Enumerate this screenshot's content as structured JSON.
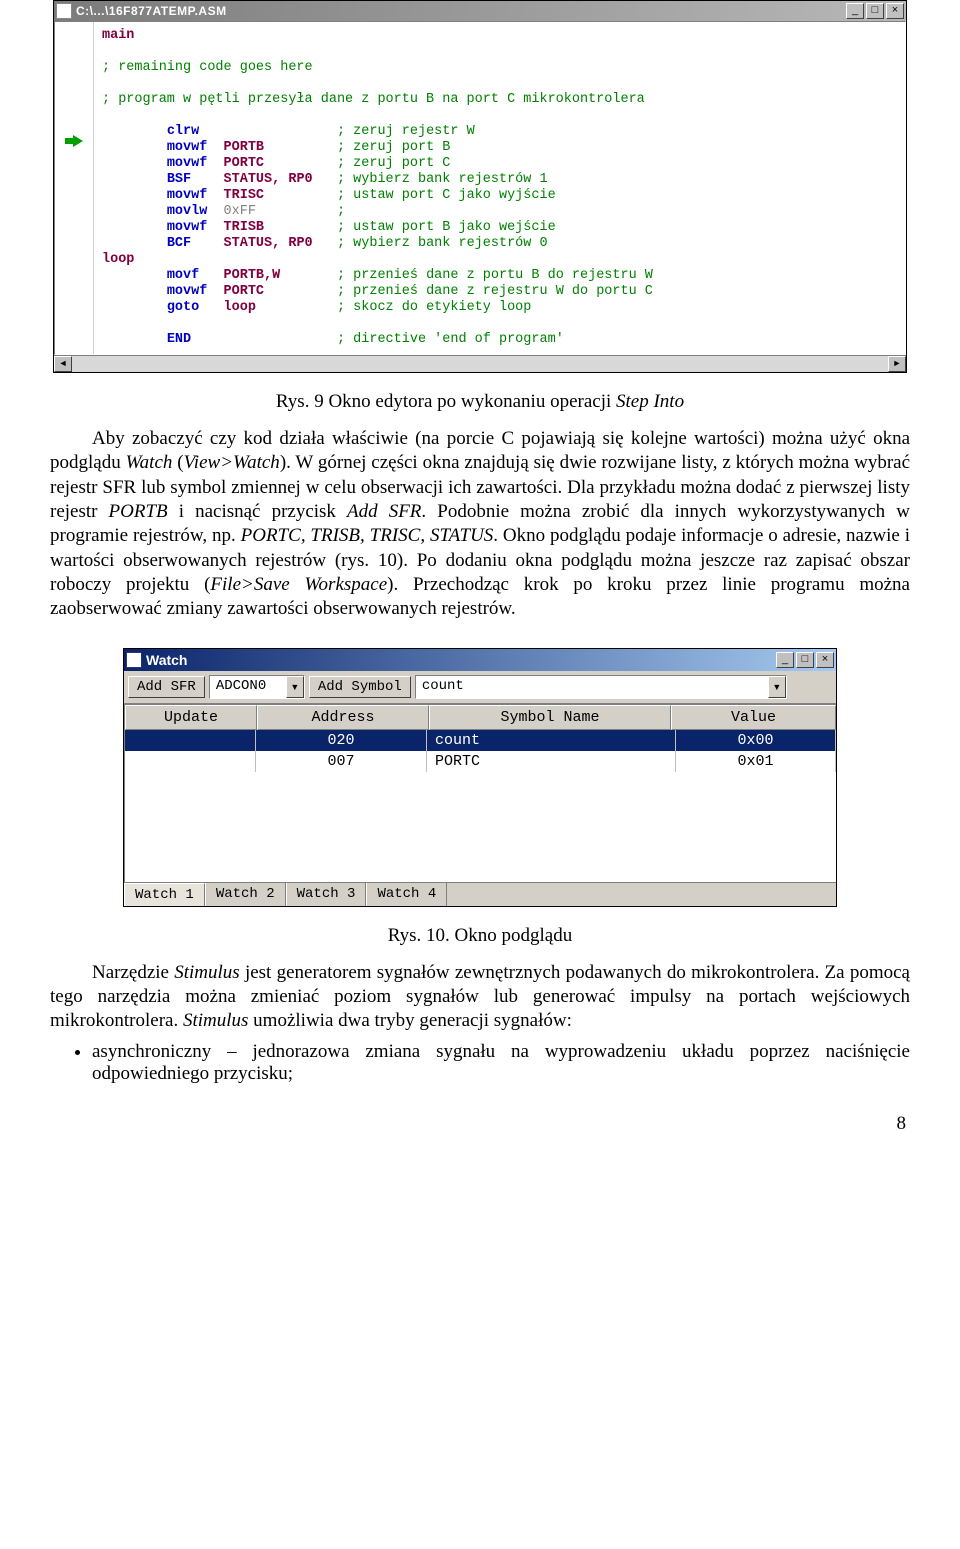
{
  "editor": {
    "title": "C:\\...\\16F877ATEMP.ASM",
    "btn_min": "_",
    "btn_max": "□",
    "btn_close": "×",
    "scroll_left": "◄",
    "scroll_right": "►",
    "code_lines": [
      {
        "lbl": "main",
        "op": "",
        "arg": "",
        "cmt": ""
      },
      {
        "lbl": "",
        "op": "",
        "arg": "",
        "cmt": ""
      },
      {
        "lbl": "",
        "op": "",
        "arg": "",
        "cmt": "; remaining code goes here"
      },
      {
        "lbl": "",
        "op": "",
        "arg": "",
        "cmt": ""
      },
      {
        "lbl": "",
        "op": "",
        "arg": "",
        "cmt": "; program w pętli przesyła dane z portu B na port C mikrokontrolera"
      },
      {
        "lbl": "",
        "op": "",
        "arg": "",
        "cmt": ""
      },
      {
        "lbl": "",
        "op": "clrw",
        "arg": "",
        "cmt": "; zeruj rejestr W"
      },
      {
        "lbl": "",
        "op": "movwf",
        "arg": "PORTB",
        "cmt": "; zeruj port B"
      },
      {
        "lbl": "",
        "op": "movwf",
        "arg": "PORTC",
        "cmt": "; zeruj port C"
      },
      {
        "lbl": "",
        "op": "BSF",
        "arg": "STATUS, RP0",
        "cmt": "; wybierz bank rejestrów 1"
      },
      {
        "lbl": "",
        "op": "movwf",
        "arg": "TRISC",
        "cmt": "; ustaw port C jako wyjście"
      },
      {
        "lbl": "",
        "op": "movlw",
        "arg": "0xFF",
        "cmt": ";"
      },
      {
        "lbl": "",
        "op": "movwf",
        "arg": "TRISB",
        "cmt": "; ustaw port B jako wejście"
      },
      {
        "lbl": "",
        "op": "BCF",
        "arg": "STATUS, RP0",
        "cmt": "; wybierz bank rejestrów 0"
      },
      {
        "lbl": "loop",
        "op": "",
        "arg": "",
        "cmt": ""
      },
      {
        "lbl": "",
        "op": "movf",
        "arg": "PORTB,W",
        "cmt": "; przenieś dane z portu B do rejestru W"
      },
      {
        "lbl": "",
        "op": "movwf",
        "arg": "PORTC",
        "cmt": "; przenieś dane z rejestru W do portu C"
      },
      {
        "lbl": "",
        "op": "goto",
        "arg": "loop",
        "cmt": "; skocz do etykiety loop"
      },
      {
        "lbl": "",
        "op": "",
        "arg": "",
        "cmt": ""
      },
      {
        "lbl": "",
        "op": "END",
        "arg": "",
        "cmt": "; directive 'end of program'"
      }
    ]
  },
  "text": {
    "cap1": "Rys. 9 Okno edytora po wykonaniu operacji ",
    "cap1_it": "Step Into",
    "p1a": "Aby zobaczyć czy kod działa właściwie (na porcie C pojawiają się kolejne wartości) można użyć okna podglądu ",
    "p1b": "Watch",
    "p1c": " (",
    "p1d": "View>Watch",
    "p1e": "). W górnej części okna znajdują się dwie rozwijane listy, z których można wybrać rejestr SFR lub symbol zmiennej w celu obserwacji ich zawartości. Dla przykładu można dodać z pierwszej listy rejestr ",
    "p1f": "PORTB",
    "p1g": " i nacisnąć przycisk ",
    "p1h": "Add SFR",
    "p1i": ". Podobnie można zrobić dla innych wykorzystywanych w programie rejestrów, np. ",
    "p1j": "PORTC, TRISB, TRISC, STATUS",
    "p1k": ". Okno podglądu podaje informacje o adresie, nazwie i wartości obserwowanych rejestrów (rys. 10). Po dodaniu okna podglądu można jeszcze raz zapisać obszar roboczy projektu (",
    "p1l": "File>Save Workspace",
    "p1m": "). Przechodząc krok po kroku przez linie programu można zaobserwować zmiany zawartości obserwowanych rejestrów.",
    "cap2": "Rys. 10. Okno podglądu",
    "p2a": "Narzędzie ",
    "p2b": "Stimulus",
    "p2c": " jest generatorem sygnałów zewnętrznych podawanych do mikrokontrolera. Za pomocą tego narzędzia można zmieniać poziom sygnałów lub generować impulsy na portach wejściowych mikrokontrolera. ",
    "p2d": "Stimulus",
    "p2e": " umożliwia dwa tryby generacji sygnałów:",
    "li1": "asynchroniczny – jednorazowa zmiana sygnału na wyprowadzeniu układu poprzez naciśnięcie odpowiedniego przycisku;",
    "pagenum": "8"
  },
  "watch": {
    "title": "Watch",
    "btn_min": "_",
    "btn_max": "□",
    "btn_close": "×",
    "add_sfr": "Add SFR",
    "sfr_val": "ADCON0",
    "add_sym": "Add Symbol",
    "sym_val": "count",
    "arrow": "▼",
    "col_update": "Update",
    "col_address": "Address",
    "col_symbol": "Symbol Name",
    "col_value": "Value",
    "rows": [
      {
        "addr": "020",
        "sym": "count",
        "val": "0x00",
        "sel": true
      },
      {
        "addr": "007",
        "sym": "PORTC",
        "val": "0x01",
        "sel": false
      }
    ],
    "tabs": [
      "Watch 1",
      "Watch 2",
      "Watch 3",
      "Watch 4"
    ]
  }
}
